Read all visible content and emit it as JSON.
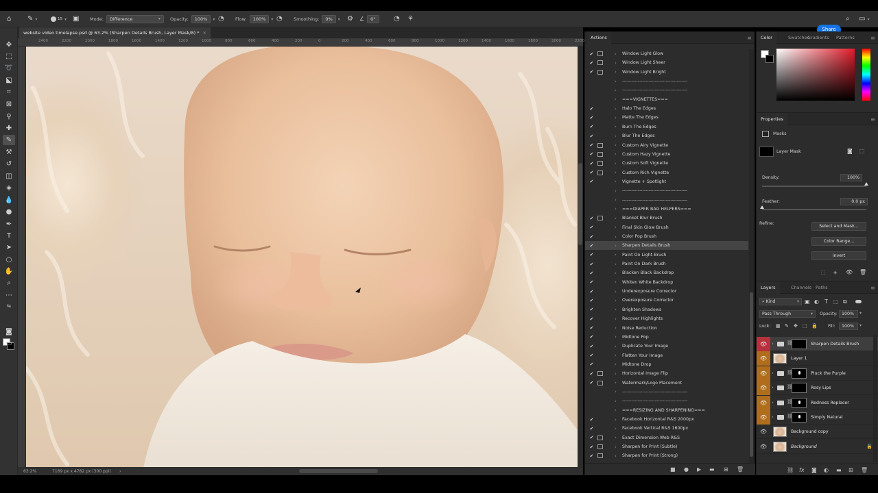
{
  "options": {
    "mode_label": "Mode:",
    "mode_value": "Difference",
    "opacity_label": "Opacity:",
    "opacity_value": "100%",
    "flow_label": "Flow:",
    "flow_value": "100%",
    "smoothing_label": "Smoothing:",
    "smoothing_value": "0%",
    "angle_value": "0°",
    "brush_size": "15"
  },
  "share_label": "Share",
  "document": {
    "tab_title": "website video timelapse.psd @ 63.2% (Sharpen Details Brush, Layer Mask/8) *",
    "close": "×"
  },
  "ruler_marks": [
    "2400",
    "2200",
    "2000",
    "1800",
    "1600",
    "1400",
    "1200",
    "1000",
    "800",
    "600",
    "400",
    "200",
    "0",
    "200",
    "400",
    "600",
    "800",
    "1000",
    "1200",
    "1400",
    "1600",
    "1800",
    "2000",
    "2200",
    "2400"
  ],
  "status": {
    "zoom": "63.2%",
    "doc_info": "7169 px x 4782 px (300 ppi)",
    "arrow": "›"
  },
  "actions_panel": {
    "tab": "Actions",
    "items": [
      {
        "name": "Window Light Glow",
        "check": true,
        "dialog": true
      },
      {
        "name": "Window Light Sheer",
        "check": true,
        "dialog": true
      },
      {
        "name": "Window Light Bright",
        "check": true,
        "dialog": true
      },
      {
        "name": "------------------------------------------",
        "check": false,
        "dialog": false
      },
      {
        "name": "------------------------------------------",
        "check": false,
        "dialog": false
      },
      {
        "name": "===VIGNETTES===",
        "check": false,
        "dialog": false
      },
      {
        "name": "Halo The Edges",
        "check": true,
        "dialog": false
      },
      {
        "name": "Matte The Edges",
        "check": true,
        "dialog": false
      },
      {
        "name": "Burn The Edges",
        "check": true,
        "dialog": false
      },
      {
        "name": "Blur The Edges",
        "check": true,
        "dialog": false
      },
      {
        "name": "Custom Airy Vignette",
        "check": true,
        "dialog": true
      },
      {
        "name": "Custom Hazy Vignette",
        "check": true,
        "dialog": true
      },
      {
        "name": "Custom Soft Vignette",
        "check": true,
        "dialog": true
      },
      {
        "name": "Custom Rich Vignette",
        "check": true,
        "dialog": true
      },
      {
        "name": "Vignette + Spotlight",
        "check": true,
        "dialog": false
      },
      {
        "name": "------------------------------------------",
        "check": false,
        "dialog": false
      },
      {
        "name": "------------------------------------------",
        "check": false,
        "dialog": false
      },
      {
        "name": "===DIAPER BAG HELPERS===",
        "check": false,
        "dialog": false
      },
      {
        "name": "Blanket Blur Brush",
        "check": true,
        "dialog": true
      },
      {
        "name": "Final Skin Glow Brush",
        "check": true,
        "dialog": false
      },
      {
        "name": "Color Pop Brush",
        "check": true,
        "dialog": false
      },
      {
        "name": "Sharpen Details Brush",
        "check": true,
        "dialog": false,
        "selected": true
      },
      {
        "name": "Paint On Light Brush",
        "check": true,
        "dialog": false
      },
      {
        "name": "Paint On Dark Brush",
        "check": true,
        "dialog": false
      },
      {
        "name": "Blacken Black Backdrop",
        "check": true,
        "dialog": false
      },
      {
        "name": "Whiten White Backdrop",
        "check": true,
        "dialog": false
      },
      {
        "name": "Underexposure Corrector",
        "check": true,
        "dialog": false
      },
      {
        "name": "Overexposure Corrector",
        "check": true,
        "dialog": false
      },
      {
        "name": "Brighten Shadows",
        "check": true,
        "dialog": false
      },
      {
        "name": "Recover Highlights",
        "check": true,
        "dialog": false
      },
      {
        "name": "Noise Reduction",
        "check": true,
        "dialog": false
      },
      {
        "name": "Midtone Pop",
        "check": true,
        "dialog": false
      },
      {
        "name": "Duplicate Your Image",
        "check": true,
        "dialog": false
      },
      {
        "name": "Flatten Your Image",
        "check": true,
        "dialog": false
      },
      {
        "name": "Midtone Drop",
        "check": true,
        "dialog": false
      },
      {
        "name": "Horizontal Image Flip",
        "check": true,
        "dialog": true
      },
      {
        "name": "Watermark/Logo Placement",
        "check": true,
        "dialog": true
      },
      {
        "name": "------------------------------------------",
        "check": false,
        "dialog": false
      },
      {
        "name": "------------------------------------------",
        "check": false,
        "dialog": false
      },
      {
        "name": "===RESIZING AND SHARPENING===",
        "check": false,
        "dialog": false
      },
      {
        "name": "Facebook Horizontal R&S 2000px",
        "check": true,
        "dialog": false
      },
      {
        "name": "Facebook Vertical R&S 1600px",
        "check": true,
        "dialog": false
      },
      {
        "name": "Exact Dimension Web R&S",
        "check": true,
        "dialog": true
      },
      {
        "name": "Sharpen for Print (Subtle)",
        "check": true,
        "dialog": true
      },
      {
        "name": "Sharpen for Print (Strong)",
        "check": true,
        "dialog": true
      }
    ]
  },
  "color_panel": {
    "tabs": [
      "Color",
      "Swatches",
      "Gradients",
      "Patterns"
    ]
  },
  "properties": {
    "tab": "Properties",
    "section": "Masks",
    "mask_label": "Layer Mask",
    "density_label": "Density:",
    "density_value": "100%",
    "density_level": 1.0,
    "feather_label": "Feather:",
    "feather_value": "0.0 px",
    "feather_level": 0.0,
    "refine_label": "Refine:",
    "buttons": [
      "Select and Mask...",
      "Color Range...",
      "Invert"
    ]
  },
  "layers_panel": {
    "tabs": [
      "Layers",
      "Channels",
      "Paths"
    ],
    "kind_label": "Kind",
    "blend_mode": "Pass Through",
    "opacity_label": "Opacity:",
    "opacity_value": "100%",
    "lock_label": "Lock:",
    "fill_label": "Fill:",
    "fill_value": "100%",
    "layers": [
      {
        "name": "Sharpen Details Brush",
        "type": "group",
        "eye": "red",
        "mask": "black",
        "selected": true
      },
      {
        "name": "Layer 1",
        "type": "pixel",
        "eye": "orange"
      },
      {
        "name": "Pluck the Purple",
        "type": "group",
        "eye": "orange",
        "mask": "dot"
      },
      {
        "name": "Rosy Lips",
        "type": "group",
        "eye": "orange",
        "mask": "black"
      },
      {
        "name": "Redness Replacer",
        "type": "group",
        "eye": "orange",
        "mask": "dot"
      },
      {
        "name": "Simply Natural",
        "type": "group",
        "eye": "orange",
        "mask": "dot"
      },
      {
        "name": "Background copy",
        "type": "pixel",
        "eye": "none"
      },
      {
        "name": "Background",
        "type": "pixel",
        "eye": "none",
        "italic": true,
        "locked": true
      }
    ]
  },
  "colors": {
    "app_bg": "#2c2c2c",
    "share": "#1473e6",
    "eye_red": "#b8303b",
    "eye_orange": "#b06d1b"
  }
}
